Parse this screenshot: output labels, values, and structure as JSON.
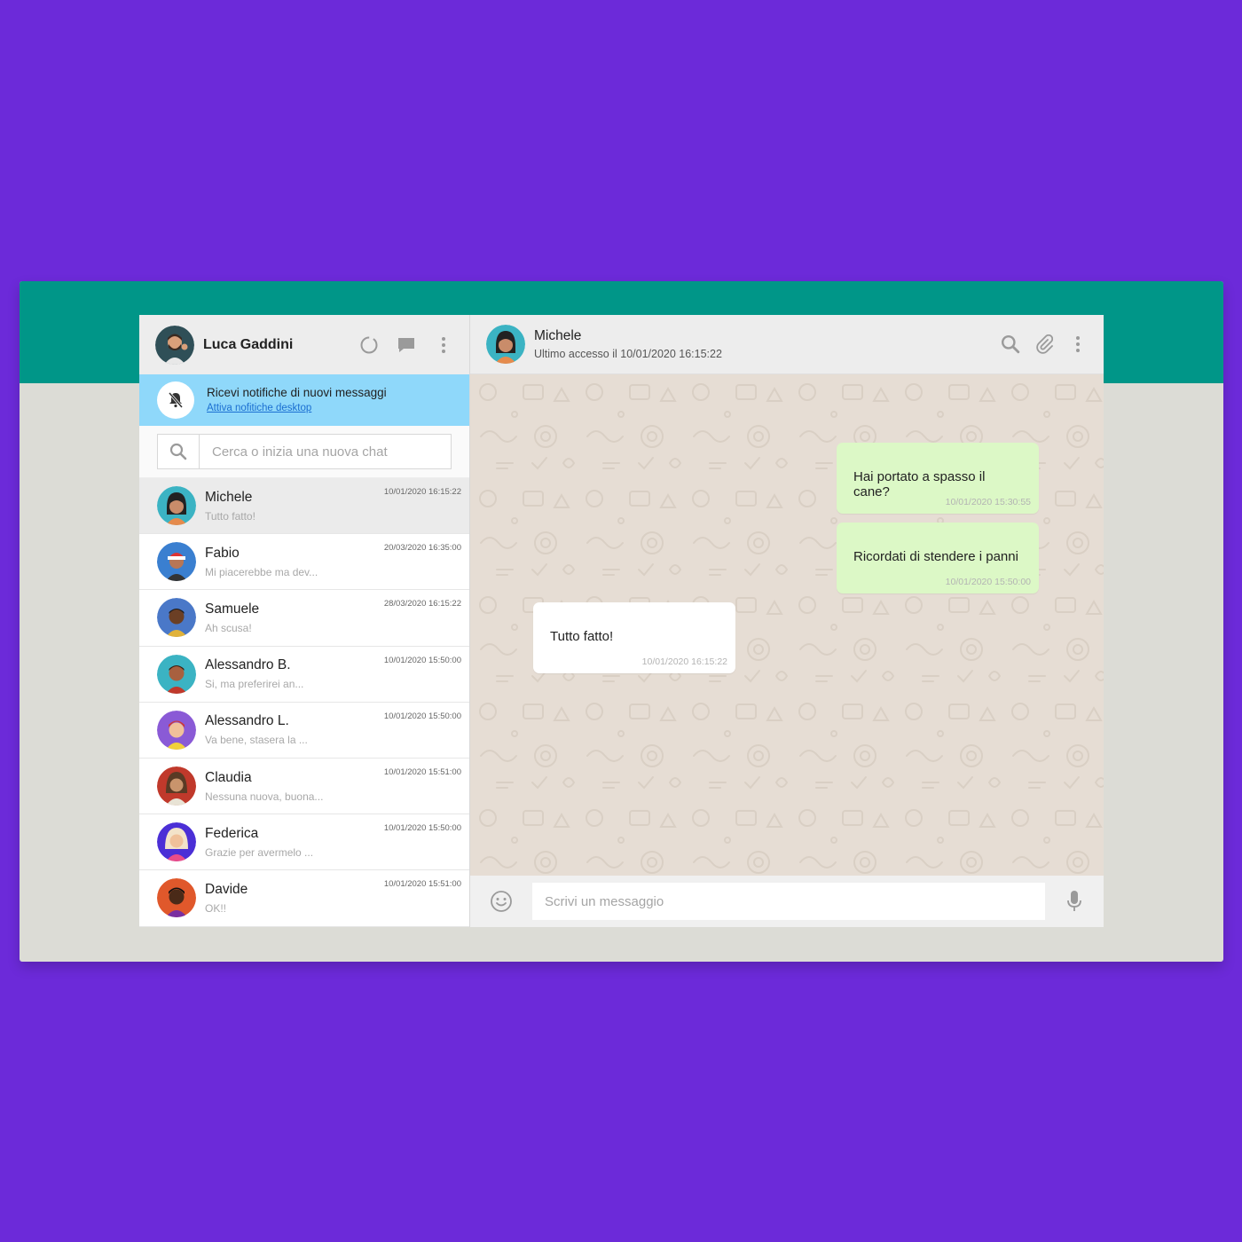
{
  "colors": {
    "background": "#6c2ad9",
    "band": "#009688",
    "notification": "#8fd8fa",
    "sent_bubble": "#dcf8c6",
    "received_bubble": "#ffffff",
    "chat_bg": "#e6ddd4"
  },
  "user": {
    "name": "Luca Gaddini",
    "icons": [
      "status-icon",
      "chat-icon",
      "menu-icon"
    ]
  },
  "notification": {
    "title": "Ricevi notifiche di nuovi messaggi",
    "link": "Attiva nofitiche desktop",
    "icon": "bell-off-icon"
  },
  "search": {
    "placeholder": "Cerca o inizia una nuova chat",
    "icon": "search-icon"
  },
  "chats": [
    {
      "name": "Michele",
      "preview": "Tutto fatto!",
      "time": "10/01/2020 16:15:22",
      "active": true
    },
    {
      "name": "Fabio",
      "preview": "Mi piacerebbe ma dev...",
      "time": "20/03/2020 16:35:00"
    },
    {
      "name": "Samuele",
      "preview": "Ah scusa!",
      "time": "28/03/2020 16:15:22"
    },
    {
      "name": "Alessandro B.",
      "preview": "Si, ma preferirei an...",
      "time": "10/01/2020 15:50:00"
    },
    {
      "name": "Alessandro L.",
      "preview": "Va bene, stasera la ...",
      "time": "10/01/2020 15:50:00"
    },
    {
      "name": "Claudia",
      "preview": "Nessuna nuova, buona...",
      "time": "10/01/2020 15:51:00"
    },
    {
      "name": "Federica",
      "preview": "Grazie per avermelo ...",
      "time": "10/01/2020 15:50:00"
    },
    {
      "name": "Davide",
      "preview": "OK!!",
      "time": "10/01/2020 15:51:00"
    }
  ],
  "contact": {
    "name": "Michele",
    "status": "Ultimo accesso il 10/01/2020 16:15:22",
    "icons": [
      "search-icon",
      "attach-icon",
      "menu-icon"
    ]
  },
  "messages": [
    {
      "text": "Hai portato a spasso il cane?",
      "time": "10/01/2020 15:30:55",
      "type": "sent"
    },
    {
      "text": "Ricordati di stendere i panni",
      "time": "10/01/2020 15:50:00",
      "type": "sent"
    },
    {
      "text": "Tutto fatto!",
      "time": "10/01/2020 16:15:22",
      "type": "received"
    }
  ],
  "composer": {
    "placeholder": "Scrivi un messaggio",
    "emoji_icon": "emoji-icon",
    "mic_icon": "microphone-icon"
  }
}
